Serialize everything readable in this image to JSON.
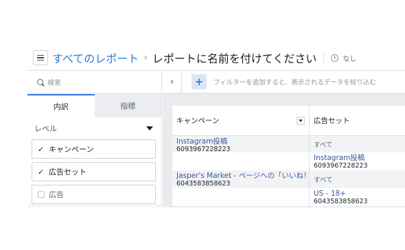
{
  "header": {
    "all_reports": "すべてのレポート",
    "separator": "›",
    "report_title": "レポートに名前を付けてください",
    "schedule": "なし"
  },
  "sidebar": {
    "search_placeholder": "検索",
    "tabs": [
      {
        "label": "内訳",
        "active": true
      },
      {
        "label": "指標",
        "active": false
      }
    ],
    "level_label": "レベル",
    "levels": [
      {
        "label": "キャンペーン",
        "checked": true,
        "check": "✓"
      },
      {
        "label": "広告セット",
        "checked": true,
        "check": "✓"
      },
      {
        "label": "広告",
        "checked": false
      }
    ]
  },
  "toolbar": {
    "back": "‹",
    "add": "+",
    "filter_placeholder": "フィルターを追加すると、表示されるデータを絞り込む"
  },
  "table": {
    "columns": [
      "キャンペーン",
      "広告セット"
    ],
    "rows": [
      {
        "campaign_name": "Instagram投稿",
        "campaign_id": "6093967228223",
        "adset_all": "すべて",
        "adset_name": "Instagram投稿",
        "adset_id": "6093967228223"
      },
      {
        "campaign_name": "Jasper's Market - ページへの「いいね！」",
        "campaign_id": "6043583858623",
        "adset_all": "すべて",
        "adset_name": "US - 18+",
        "adset_id": "6043583858623"
      }
    ]
  },
  "colors": {
    "accent": "#3578e5",
    "link": "#385898",
    "panel": "#f5f6f7",
    "grid_bg": "#e9ebee"
  }
}
